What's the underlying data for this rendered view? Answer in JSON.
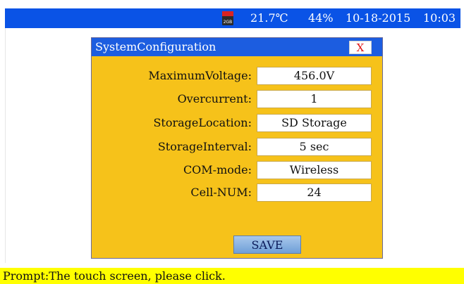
{
  "status_bar": {
    "sd_icon_label": "2GB",
    "temperature": "21.7℃",
    "humidity": "44%",
    "date": "10-18-2015",
    "time": "10:03"
  },
  "dialog": {
    "title": "SystemConfiguration",
    "close_label": "X",
    "fields": [
      {
        "label": "MaximumVoltage:",
        "value": "456.0V"
      },
      {
        "label": "Overcurrent:",
        "value": "1"
      },
      {
        "label": "StorageLocation:",
        "value": "SD Storage"
      },
      {
        "label": "StorageInterval:",
        "value": "5 sec"
      },
      {
        "label": "COM-mode:",
        "value": "Wireless"
      },
      {
        "label": "Cell-NUM:",
        "value": "24"
      }
    ],
    "save_label": "SAVE"
  },
  "prompt": {
    "text": "Prompt:The touch screen, please click."
  },
  "colors": {
    "status_bar_bg": "#0a53e6",
    "dialog_bg": "#f6c21a",
    "prompt_bg": "#ffff00",
    "close_text": "#e01414"
  }
}
